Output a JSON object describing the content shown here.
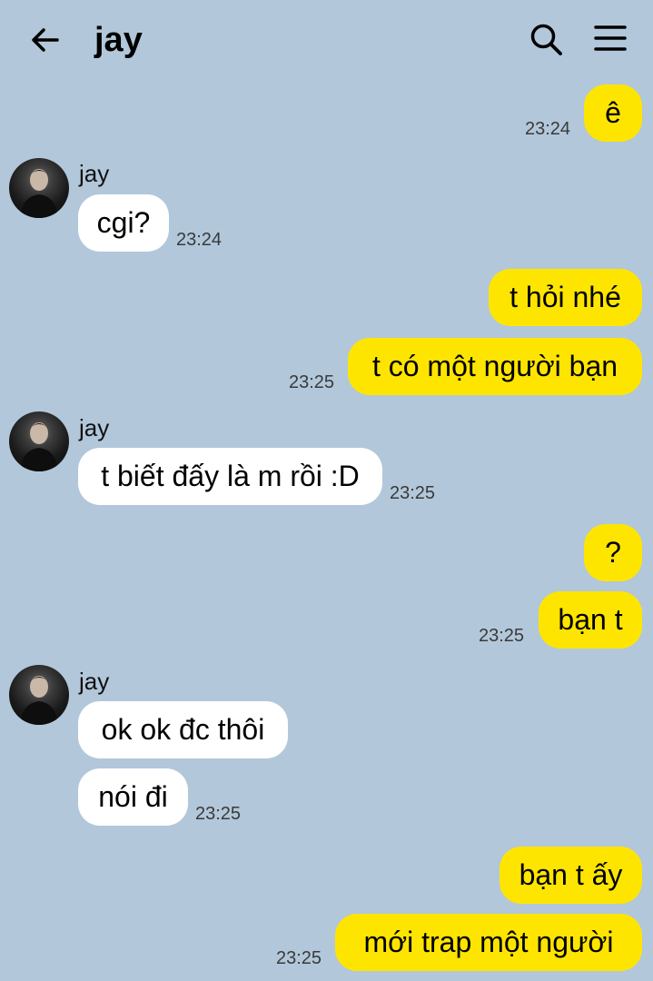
{
  "header": {
    "title": "jay",
    "back_icon": "arrow-left-icon",
    "search_icon": "search-icon",
    "menu_icon": "hamburger-menu-icon"
  },
  "colors": {
    "background": "#b2c7da",
    "my_bubble": "#fee500",
    "their_bubble": "#ffffff"
  },
  "messages": [
    {
      "sender": "me",
      "text": "ê",
      "time": "23:24"
    },
    {
      "sender": "jay",
      "text": "cgi?",
      "time": "23:24"
    },
    {
      "sender": "me",
      "text": "t hỏi nhé"
    },
    {
      "sender": "me",
      "text": "t có một người bạn",
      "time": "23:25"
    },
    {
      "sender": "jay",
      "text": "t biết đấy là m rồi :D",
      "time": "23:25"
    },
    {
      "sender": "me",
      "text": "?"
    },
    {
      "sender": "me",
      "text": "bạn t",
      "time": "23:25"
    },
    {
      "sender": "jay",
      "text": "ok ok đc thôi"
    },
    {
      "sender": "jay",
      "text": "nói đi",
      "time": "23:25"
    },
    {
      "sender": "me",
      "text": "bạn t ấy"
    },
    {
      "sender": "me",
      "text": "mới trap một người",
      "time": "23:25"
    }
  ]
}
